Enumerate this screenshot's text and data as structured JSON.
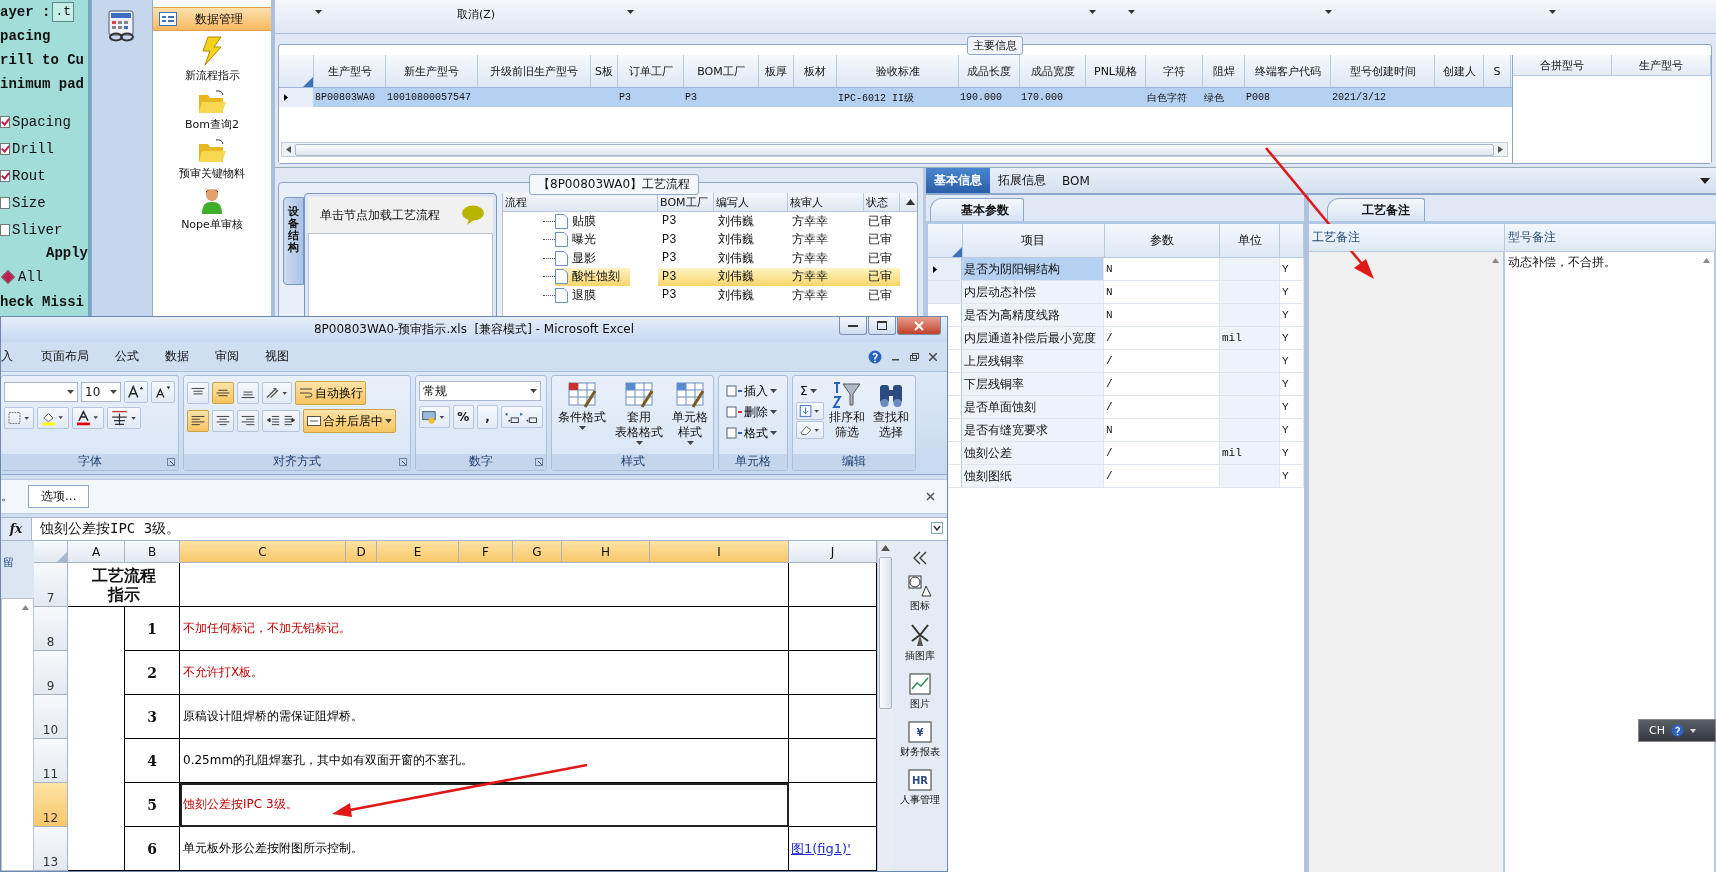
{
  "left_panel": {
    "layer_label": "ayer :",
    "layer_value": ".t",
    "lines": [
      "pacing",
      "rill to Cu",
      "inimum pad"
    ],
    "checks": [
      {
        "label": "Spacing",
        "checked": true
      },
      {
        "label": "Drill",
        "checked": true
      },
      {
        "label": "Rout",
        "checked": true
      },
      {
        "label": "Size",
        "checked": false
      },
      {
        "label": "Sliver",
        "checked": false
      }
    ],
    "apply": "Apply",
    "radios": [
      {
        "label": "All",
        "selected": true
      }
    ],
    "check_missing": "heck Missi"
  },
  "nav": {
    "header": "数据管理",
    "items": [
      {
        "label": "新流程指示",
        "kind": "bolt"
      },
      {
        "label": "Bom查询2",
        "kind": "folder"
      },
      {
        "label": "预审关键物料",
        "kind": "folder"
      },
      {
        "label": "Nope单审核",
        "kind": "person"
      }
    ]
  },
  "toolbar": {
    "cancel": "取消(Z)"
  },
  "main_info": {
    "title": "主要信息",
    "columns": [
      "生产型号",
      "新生产型号",
      "升级前旧生产型号",
      "S板",
      "订单工厂",
      "BOM工厂",
      "板厚",
      "板材",
      "验收标准",
      "成品长度",
      "成品宽度",
      "PNL规格",
      "字符",
      "阻焊",
      "终端客户代码",
      "型号创建时间",
      "创建人",
      "S"
    ],
    "rows": [
      {
        "selected": true,
        "cells": [
          "8P00803WA0",
          "10010800057547",
          null,
          null,
          "P3",
          "P3",
          null,
          null,
          "IPC-6012 II级",
          "190.000",
          "170.000",
          null,
          "白色字符",
          "绿色",
          "P008",
          "2021/3/12",
          null,
          null
        ]
      }
    ],
    "side_columns": [
      "合拼型号",
      "生产型号"
    ]
  },
  "process": {
    "title": "【8P00803WA0】工艺流程",
    "side_tab": "设备结构",
    "hint": "单击节点加载工艺流程",
    "columns": [
      "流程",
      "BOM工厂",
      "编写人",
      "核审人",
      "状态"
    ],
    "rows": [
      {
        "name": "贴膜",
        "factory": "P3",
        "writer": "刘伟巍",
        "reviewer": "方幸幸",
        "status": "已审",
        "selected": false
      },
      {
        "name": "曝光",
        "factory": "P3",
        "writer": "刘伟巍",
        "reviewer": "方幸幸",
        "status": "已审",
        "selected": false
      },
      {
        "name": "显影",
        "factory": "P3",
        "writer": "刘伟巍",
        "reviewer": "方幸幸",
        "status": "已审",
        "selected": false
      },
      {
        "name": "酸性蚀刻",
        "factory": "P3",
        "writer": "刘伟巍",
        "reviewer": "方幸幸",
        "status": "已审",
        "selected": true
      },
      {
        "name": "退膜",
        "factory": "P3",
        "writer": "刘伟巍",
        "reviewer": "方幸幸",
        "status": "已审",
        "selected": false
      }
    ]
  },
  "detail_tabs": [
    {
      "label": "基本信息",
      "selected": true
    },
    {
      "label": "拓展信息",
      "selected": false
    },
    {
      "label": "BOM",
      "selected": false
    }
  ],
  "params": {
    "tab": "基本参数",
    "columns": [
      "项目",
      "参数",
      "单位"
    ],
    "rows": [
      {
        "item": "是否为阴阳铜结构",
        "value": "N",
        "unit": null,
        "flag": "Y",
        "selected": true
      },
      {
        "item": "内层动态补偿",
        "value": "N",
        "unit": null,
        "flag": "Y",
        "selected": false
      },
      {
        "item": "是否为高精度线路",
        "value": "N",
        "unit": null,
        "flag": "Y",
        "selected": false
      },
      {
        "item": "内层通道补偿后最小宽度",
        "value": "/",
        "unit": "mil",
        "flag": "Y",
        "selected": false
      },
      {
        "item": "上层残铜率",
        "value": "/",
        "unit": null,
        "flag": "Y",
        "selected": false
      },
      {
        "item": "下层残铜率",
        "value": "/",
        "unit": null,
        "flag": "Y",
        "selected": false
      },
      {
        "item": "是否单面蚀刻",
        "value": "/",
        "unit": null,
        "flag": "Y",
        "selected": false
      },
      {
        "item": "是否有缝宽要求",
        "value": "N",
        "unit": null,
        "flag": "Y",
        "selected": false
      },
      {
        "item": "蚀刻公差",
        "value": "/",
        "unit": "mil",
        "flag": "Y",
        "selected": false
      },
      {
        "item": "蚀刻图纸",
        "value": "/",
        "unit": null,
        "flag": "Y",
        "selected": false
      }
    ]
  },
  "notes": {
    "tab": "工艺备注",
    "columns": [
      "工艺备注",
      "型号备注"
    ],
    "model_note": "动态补偿，不合拼。"
  },
  "excel": {
    "title": "8P00803WA0-预审指示.xls  [兼容模式] - Microsoft Excel",
    "tabs": [
      "入",
      "页面布局",
      "公式",
      "数据",
      "审阅",
      "视图"
    ],
    "ribbon": [
      {
        "kind": "font",
        "label": "字体",
        "size": "10"
      },
      {
        "kind": "align",
        "label": "对齐方式",
        "buttons": [
          {
            "label": "自动换行",
            "on": true
          },
          {
            "label": "合并后居中",
            "on": true
          }
        ]
      },
      {
        "kind": "number",
        "label": "数字",
        "format": "常规",
        "symbols": [
          "%",
          ","
        ]
      },
      {
        "kind": "styles",
        "label": "样式",
        "buttons": [
          {
            "lines": [
              "条件格式"
            ]
          },
          {
            "lines": [
              "套用",
              "表格格式"
            ]
          },
          {
            "lines": [
              "单元格",
              "样式"
            ]
          }
        ]
      },
      {
        "kind": "cells",
        "label": "单元格",
        "buttons": [
          "插入",
          "删除",
          "格式"
        ]
      },
      {
        "kind": "editing",
        "label": "编辑",
        "sigma": "Σ",
        "buttons": [
          {
            "lines": [
              "排序和",
              "筛选"
            ]
          },
          {
            "lines": [
              "查找和",
              "选择"
            ]
          }
        ]
      }
    ],
    "message": {
      "text": "。",
      "button": "选项..."
    },
    "formula": {
      "label": "fx",
      "value": "蚀刻公差按IPC 3级。"
    },
    "left_label": "留",
    "columns": [
      {
        "label": "A",
        "selected": false
      },
      {
        "label": "B",
        "selected": false
      },
      {
        "label": "C",
        "selected": true
      },
      {
        "label": "D",
        "selected": true
      },
      {
        "label": "E",
        "selected": true
      },
      {
        "label": "F",
        "selected": true
      },
      {
        "label": "G",
        "selected": true
      },
      {
        "label": "H",
        "selected": true
      },
      {
        "label": "I",
        "selected": true
      },
      {
        "label": "J",
        "selected": false
      }
    ],
    "title_row": {
      "row": "7",
      "text": "工艺流程指示"
    },
    "rows": [
      {
        "row": "8",
        "num": "1",
        "text": "不加任何标记，不加无铅标记。",
        "emphasis": true,
        "selected": false
      },
      {
        "row": "9",
        "num": "2",
        "text": "不允许打X板。",
        "emphasis": true,
        "selected": false
      },
      {
        "row": "10",
        "num": "3",
        "text": "原稿设计阻焊桥的需保证阻焊桥。",
        "emphasis": false,
        "selected": false
      },
      {
        "row": "11",
        "num": "4",
        "text": "0.25mm的孔阻焊塞孔，其中如有双面开窗的不塞孔。",
        "emphasis": false,
        "selected": false
      },
      {
        "row": "12",
        "num": "5",
        "text": "蚀刻公差按IPC 3级。",
        "emphasis": true,
        "selected": true
      },
      {
        "row": "13",
        "num": "6",
        "text": "单元板外形公差按附图所示控制。",
        "emphasis": false,
        "selected": false,
        "link": "图1(fig1)'"
      }
    ],
    "side_pane": [
      {
        "label": "图标",
        "kind": "shapes"
      },
      {
        "label": "插图库",
        "kind": "windmill"
      },
      {
        "label": "图片",
        "kind": "image"
      },
      {
        "label": "财务报表",
        "kind": "finance",
        "glyph": "¥"
      },
      {
        "label": "人事管理",
        "kind": "hr",
        "glyph": "HR"
      }
    ]
  },
  "ime": {
    "label": "CH"
  }
}
